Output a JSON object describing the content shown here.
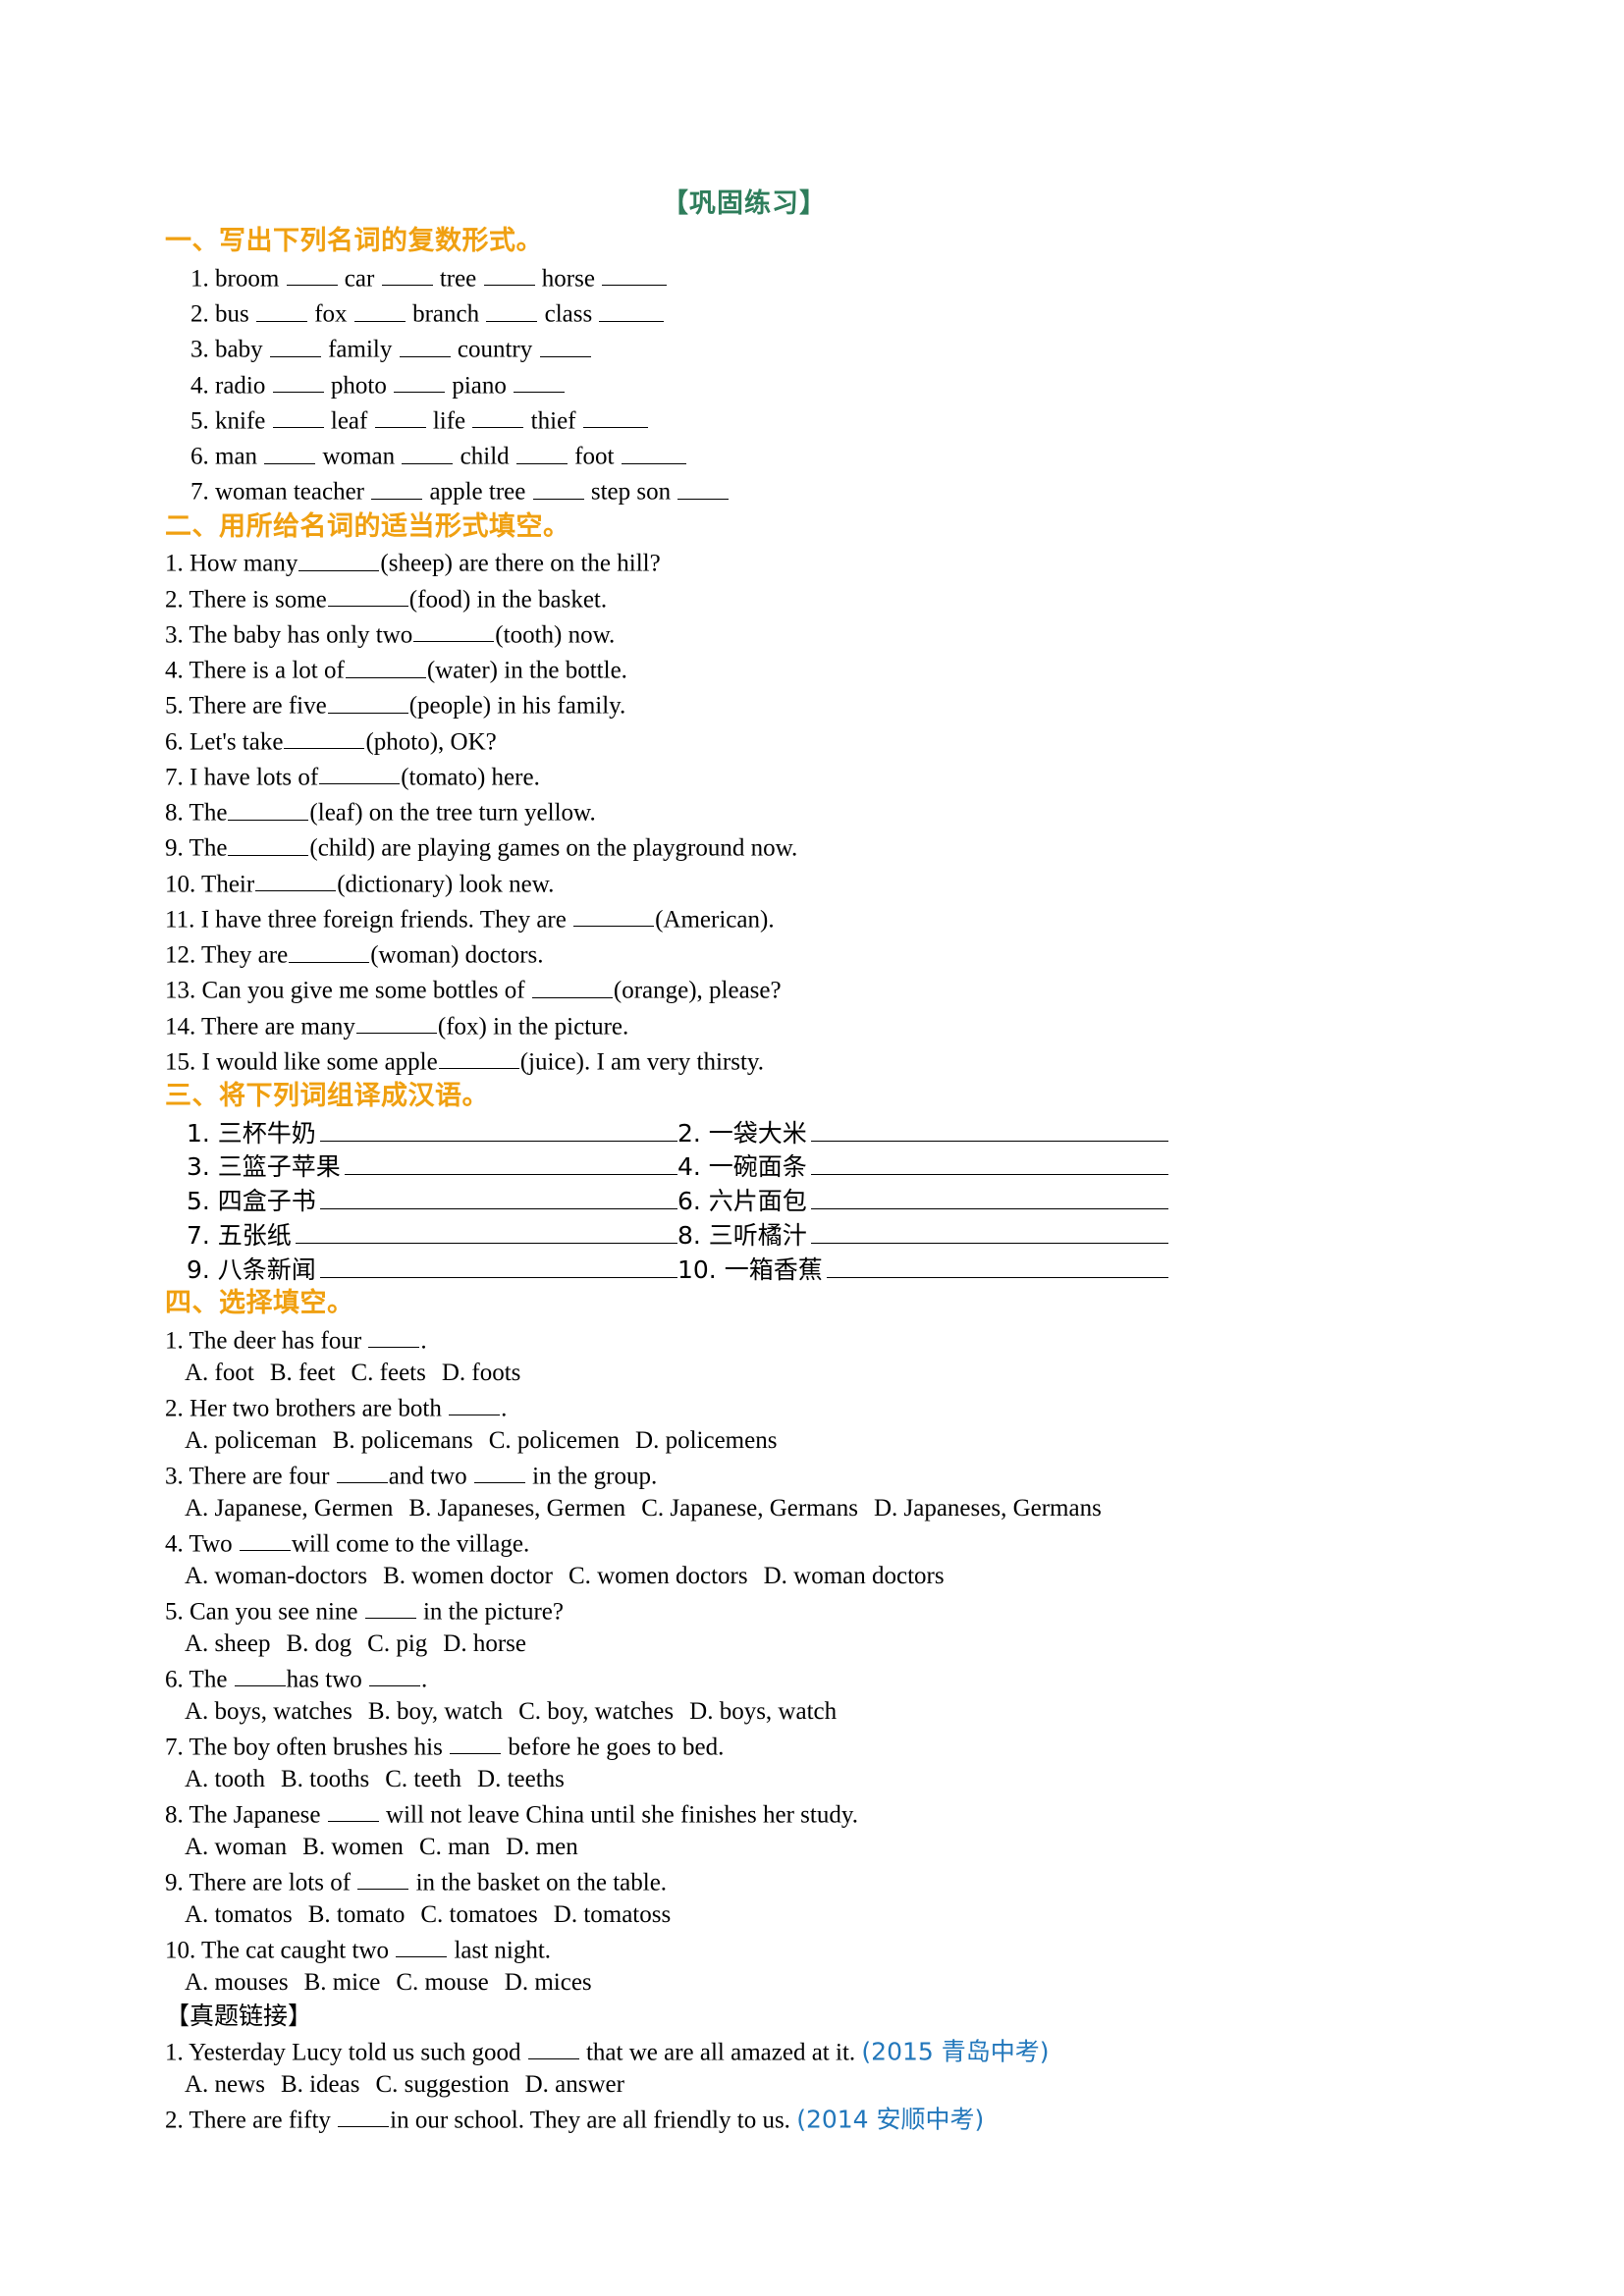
{
  "document": {
    "title": "【巩固练习】",
    "title_color": "#2e7d5b",
    "heading_color": "#f0a011",
    "exam_ref_color": "#2277bb"
  },
  "section1": {
    "heading": "一、写出下列名词的复数形式。",
    "items": [
      {
        "num": "1.",
        "words": [
          "broom",
          "car",
          "tree",
          "horse"
        ]
      },
      {
        "num": "2.",
        "words": [
          "bus",
          "fox",
          "branch",
          "class"
        ]
      },
      {
        "num": "3.",
        "words": [
          "baby",
          "family",
          "country"
        ]
      },
      {
        "num": "4.",
        "words": [
          "radio",
          "photo",
          "piano"
        ]
      },
      {
        "num": "5.",
        "words": [
          "knife",
          "leaf",
          "life",
          "thief"
        ]
      },
      {
        "num": "6.",
        "words": [
          "man",
          "woman",
          "child",
          "foot"
        ]
      },
      {
        "num": "7.",
        "words": [
          "woman teacher",
          "apple tree",
          "step son"
        ]
      }
    ]
  },
  "section2": {
    "heading": "二、用所给名词的适当形式填空。",
    "items": [
      {
        "num": "1.",
        "before": "How many",
        "cue": "(sheep)",
        "after": " are there on the hill?"
      },
      {
        "num": "2.",
        "before": "There is some",
        "cue": "(food)",
        "after": " in the basket."
      },
      {
        "num": "3.",
        "before": "The baby has only two",
        "cue": "(tooth)",
        "after": " now."
      },
      {
        "num": "4.",
        "before": "There is a lot of",
        "cue": "(water)",
        "after": " in the bottle."
      },
      {
        "num": "5.",
        "before": "There are five",
        "cue": "(people)",
        "after": " in his family."
      },
      {
        "num": "6.",
        "before": "Let's take",
        "cue": "(photo)",
        "after": ", OK?"
      },
      {
        "num": "7.",
        "before": "I have lots of",
        "cue": "(tomato)",
        "after": " here."
      },
      {
        "num": "8.",
        "before": "The",
        "cue": "(leaf)",
        "after": " on the tree turn yellow."
      },
      {
        "num": "9.",
        "before": "The",
        "cue": "(child)",
        "after": " are playing games on the playground now."
      },
      {
        "num": "10.",
        "before": "Their",
        "cue": "(dictionary)",
        "after": " look new."
      },
      {
        "num": "11.",
        "before": "I have three foreign friends. They are ",
        "cue": "(American).",
        "after": ""
      },
      {
        "num": "12.",
        "before": "They are",
        "cue": "(woman)",
        "after": " doctors."
      },
      {
        "num": "13.",
        "before": "Can you give me some bottles of ",
        "cue": "(orange)",
        "after": ", please?"
      },
      {
        "num": "14.",
        "before": "There are many",
        "cue": "(fox)",
        "after": " in the picture."
      },
      {
        "num": "15.",
        "before": "I would like some apple",
        "cue": "(juice)",
        "after": ". I am very thirsty."
      }
    ]
  },
  "section3": {
    "heading": "三、将下列词组译成汉语。",
    "rows": [
      {
        "left_num": "1.",
        "left_text": "三杯牛奶",
        "right_num": "2.",
        "right_text": "一袋大米"
      },
      {
        "left_num": "3.",
        "left_text": "三篮子苹果",
        "right_num": "4.",
        "right_text": "一碗面条"
      },
      {
        "left_num": "5.",
        "left_text": "四盒子书",
        "right_num": "6.",
        "right_text": "六片面包"
      },
      {
        "left_num": "7.",
        "left_text": "五张纸",
        "right_num": "8.",
        "right_text": "三听橘汁"
      },
      {
        "left_num": "9.",
        "left_text": "八条新闻",
        "right_num": "10.",
        "right_text": "一箱香蕉"
      }
    ]
  },
  "section4": {
    "heading": "四、选择填空。",
    "items": [
      {
        "num": "1.",
        "before": "The deer has four ",
        "after": ".",
        "options": [
          "A. foot",
          "B. feet",
          "C. feets",
          "D. foots"
        ]
      },
      {
        "num": "2.",
        "before": "Her two brothers are both ",
        "after": ".",
        "options": [
          "A. policeman",
          "B. policemans",
          "C. policemen",
          "D. policemens"
        ]
      },
      {
        "num": "3.",
        "before": "There are four ",
        "middle": "and two ",
        "after": " in the group.",
        "options": [
          "A. Japanese, Germen",
          "B. Japaneses, Germen",
          "C. Japanese, Germans",
          "D. Japaneses, Germans"
        ]
      },
      {
        "num": "4.",
        "before": "Two ",
        "after": "will come to the village.",
        "options": [
          "A. woman-doctors",
          "B. women doctor",
          "C. women doctors",
          "D. woman doctors"
        ]
      },
      {
        "num": "5.",
        "before": "Can you see nine ",
        "after": " in the picture?",
        "options": [
          "A. sheep",
          "B. dog",
          "C. pig",
          "D. horse"
        ]
      },
      {
        "num": "6.",
        "before": "The ",
        "middle": "has two ",
        "after": ".",
        "options": [
          "A. boys, watches",
          "B. boy, watch",
          "C. boy, watches",
          "D. boys, watch"
        ]
      },
      {
        "num": "7.",
        "before": "The boy often brushes his ",
        "after": " before he goes to bed.",
        "options": [
          "A. tooth",
          "B. tooths",
          "C. teeth",
          "D. teeths"
        ]
      },
      {
        "num": "8.",
        "before": "The Japanese ",
        "after": " will not leave China until she finishes her study.",
        "options": [
          "A. woman",
          "B. women",
          "C. man",
          "D. men"
        ]
      },
      {
        "num": "9.",
        "before": "There are lots of ",
        "after": " in the basket on the table.",
        "options": [
          "A. tomatos",
          "B. tomato",
          "C. tomatoes",
          "D. tomatoss"
        ]
      },
      {
        "num": "10.",
        "before": "The cat caught two ",
        "after": " last night.",
        "options": [
          "A. mouses",
          "B. mice",
          "C. mouse",
          "D. mices"
        ]
      }
    ]
  },
  "section5": {
    "heading": "【真题链接】",
    "items": [
      {
        "num": "1.",
        "before": "Yesterday Lucy told us such good ",
        "after": " that we are all amazed at it. ",
        "exam_ref": "(2015 青岛中考)",
        "options": [
          "A. news",
          "B. ideas",
          "C. suggestion",
          "D. answer"
        ]
      },
      {
        "num": "2.",
        "before": "There are fifty ",
        "after": "in our school. They are all friendly to us. ",
        "exam_ref": "(2014 安顺中考)",
        "options": []
      }
    ]
  }
}
